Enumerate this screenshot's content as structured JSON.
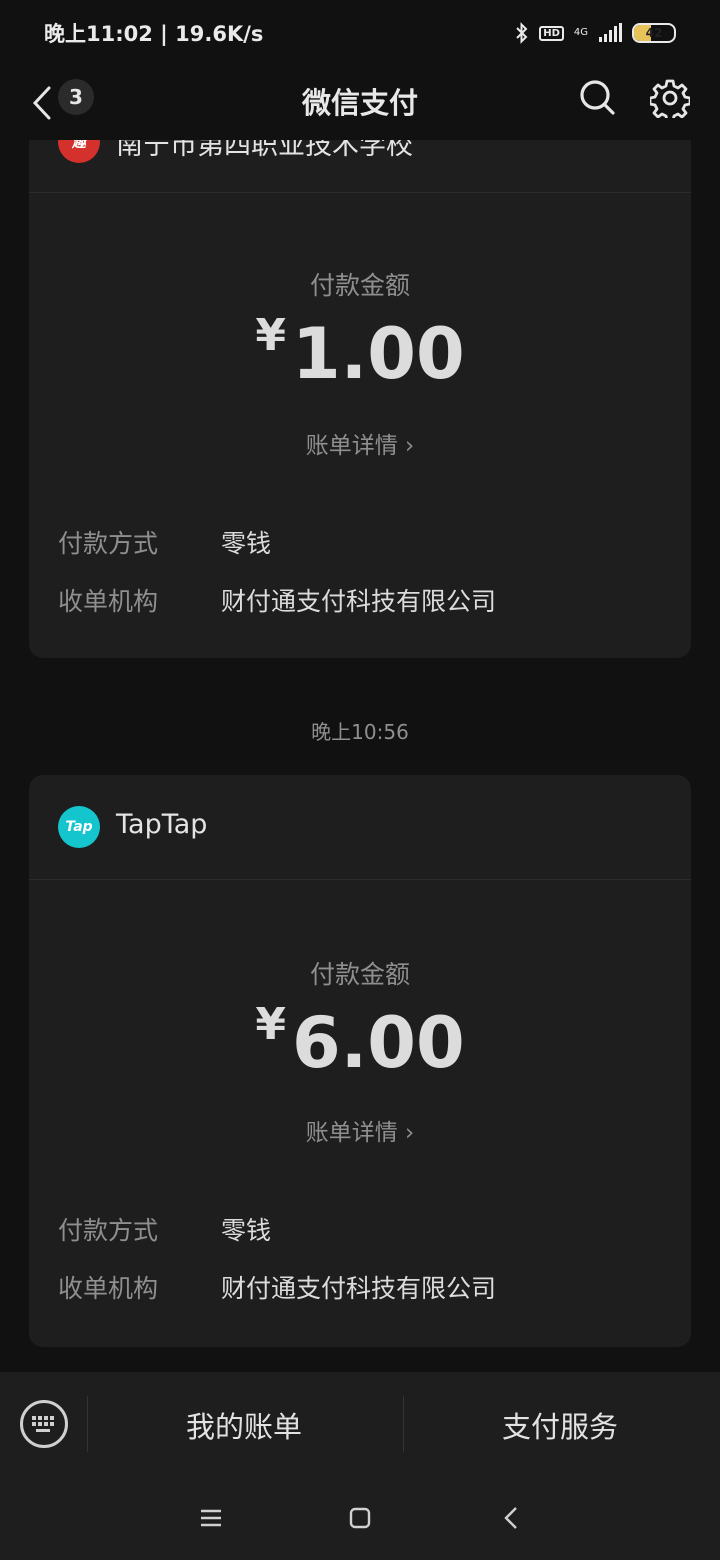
{
  "status_bar": {
    "time_speed": "晚上11:02 | 19.6K/s",
    "network": "4G",
    "hd": "HD",
    "battery": "42",
    "battery_level": 0.42
  },
  "nav": {
    "back_badge": "3",
    "title": "微信支付"
  },
  "card1": {
    "merchant_name": "南宁市第四职业技术学校",
    "amount_label": "付款金额",
    "currency": "¥",
    "amount": "1.00",
    "detail_link": "账单详情 ›",
    "rows": [
      {
        "key": "付款方式",
        "value": "零钱"
      },
      {
        "key": "收单机构",
        "value": "财付通支付科技有限公司"
      }
    ]
  },
  "timestamp": "晚上10:56",
  "card2": {
    "merchant_name": "TapTap",
    "merchant_logo": "Tap",
    "amount_label": "付款金额",
    "currency": "¥",
    "amount": "6.00",
    "detail_link": "账单详情 ›",
    "rows": [
      {
        "key": "付款方式",
        "value": "零钱"
      },
      {
        "key": "收单机构",
        "value": "财付通支付科技有限公司"
      }
    ]
  },
  "bottom_menu": {
    "item1": "我的账单",
    "item2": "支付服务"
  },
  "colors": {
    "background": "#111111",
    "card": "#1e1e1e",
    "taptap": "#15c5ce",
    "school": "#d4302c"
  }
}
